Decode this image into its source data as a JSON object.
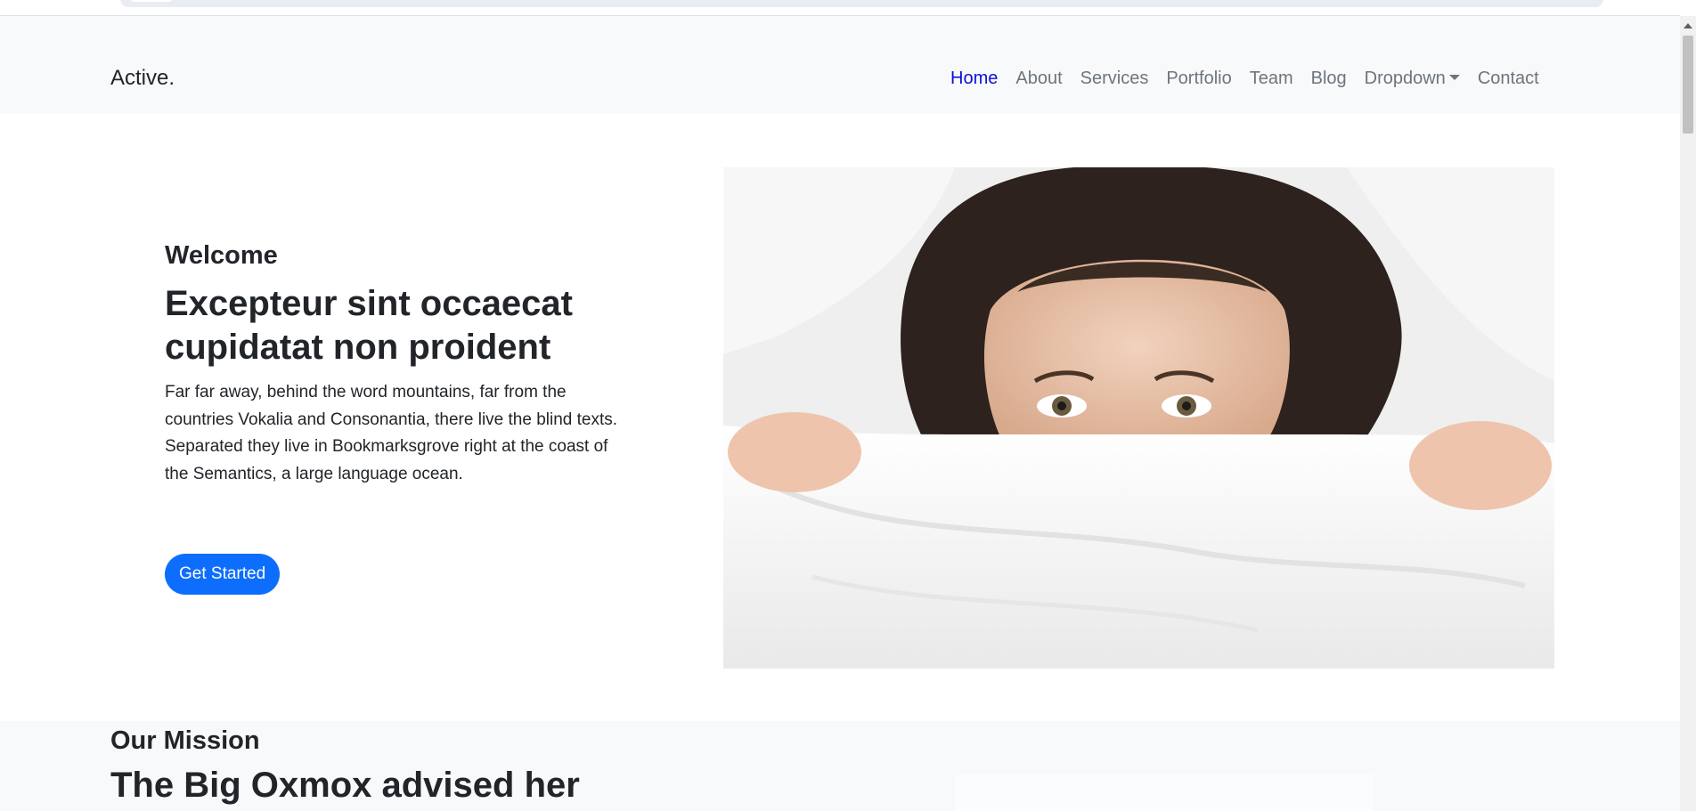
{
  "navbar": {
    "brand": "Active.",
    "items": [
      {
        "label": "Home",
        "active": true
      },
      {
        "label": "About"
      },
      {
        "label": "Services"
      },
      {
        "label": "Portfolio"
      },
      {
        "label": "Team"
      },
      {
        "label": "Blog"
      },
      {
        "label": "Dropdown",
        "has_caret": true
      },
      {
        "label": "Contact"
      }
    ]
  },
  "hero": {
    "kicker": "Welcome",
    "headline": "Excepteur sint occaecat cupidatat non proident",
    "lead": "Far far away, behind the word mountains, far from the countries Vokalia and Consonantia, there live the blind texts. Separated they live in Bookmarksgrove right at the coast of the Semantics, a large language ocean.",
    "cta_label": "Get Started"
  },
  "mission": {
    "kicker": "Our Mission",
    "title": "The Big Oxmox advised her"
  },
  "colors": {
    "accent": "#0d6efd",
    "nav_active": "#0d10d6",
    "nav_text": "#6c757d",
    "navbar_bg": "#f8f9fa"
  }
}
